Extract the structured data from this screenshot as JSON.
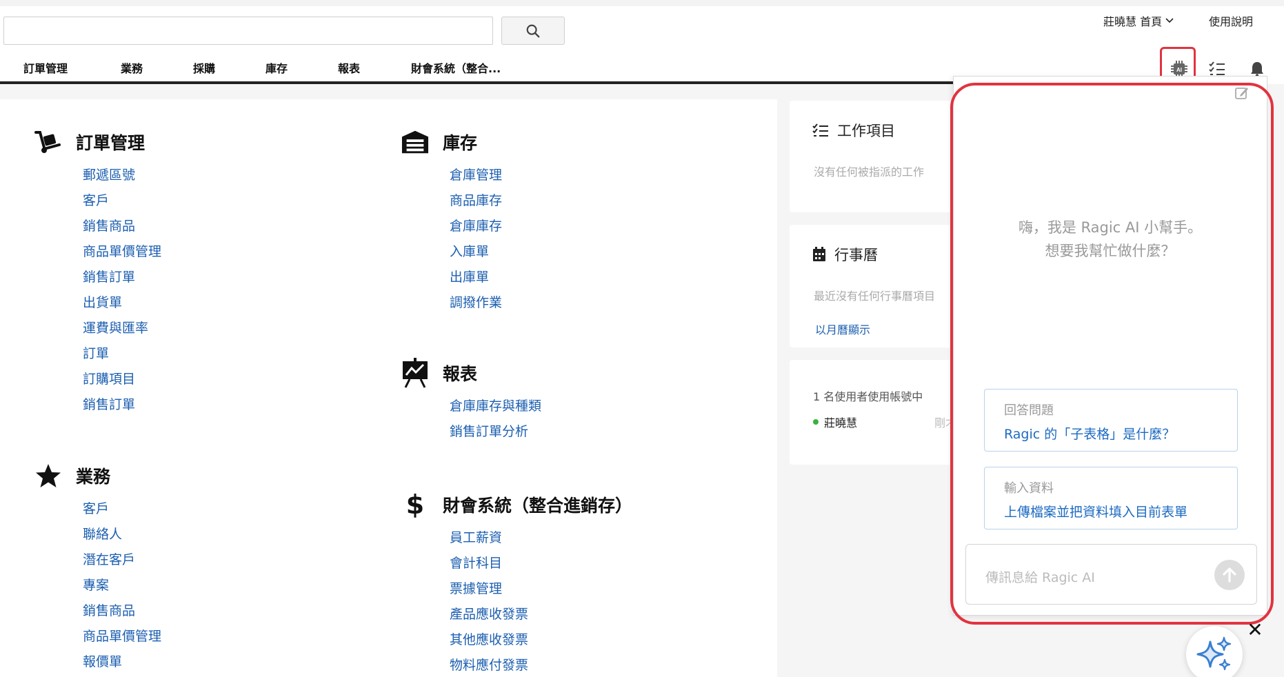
{
  "search": {
    "value": "",
    "placeholder": ""
  },
  "header": {
    "user_menu": "莊曉慧 首頁",
    "help": "使用說明"
  },
  "nav": {
    "tabs": [
      "訂單管理",
      "業務",
      "採購",
      "庫存",
      "報表",
      "財會系統（整合..."
    ]
  },
  "sections": {
    "orders": {
      "title": "訂單管理",
      "links": [
        "郵遞區號",
        "客戶",
        "銷售商品",
        "商品單價管理",
        "銷售訂單",
        "出貨單",
        "運費與匯率",
        "訂單",
        "訂購項目",
        "銷售訂單"
      ]
    },
    "business": {
      "title": "業務",
      "links": [
        "客戶",
        "聯絡人",
        "潛在客戶",
        "專案",
        "銷售商品",
        "商品單價管理",
        "報價單"
      ]
    },
    "inventory": {
      "title": "庫存",
      "links": [
        "倉庫管理",
        "商品庫存",
        "倉庫庫存",
        "入庫單",
        "出庫單",
        "調撥作業"
      ]
    },
    "reports": {
      "title": "報表",
      "links": [
        "倉庫庫存與種類",
        "銷售訂單分析"
      ]
    },
    "finance": {
      "title": "財會系統（整合進銷存）",
      "links": [
        "員工薪資",
        "會計科目",
        "票據管理",
        "產品應收發票",
        "其他應收發票",
        "物料應付發票"
      ]
    }
  },
  "side": {
    "tasks": {
      "title": "工作項目",
      "empty": "沒有任何被指派的工作"
    },
    "calendar": {
      "title": "行事曆",
      "empty": "最近沒有任何行事曆項目",
      "link": "以月曆顯示"
    },
    "users": {
      "active": "1 名使用者使用帳號中",
      "name": "莊曉慧",
      "time": "剛才"
    }
  },
  "ai": {
    "greeting_line1": "嗨，我是 Ragic AI 小幫手。",
    "greeting_line2": "想要我幫忙做什麼？",
    "suggestions": [
      {
        "label": "回答問題",
        "text": "Ragic 的「子表格」是什麼？"
      },
      {
        "label": "輸入資料",
        "text": "上傳檔案並把資料填入目前表單"
      }
    ],
    "input_placeholder": "傳訊息給 Ragic AI",
    "close": "✕"
  },
  "colors": {
    "link": "#1c5fb0",
    "highlight": "#e2333f",
    "ai_link": "#1c6ac2",
    "online": "#3cb043"
  }
}
